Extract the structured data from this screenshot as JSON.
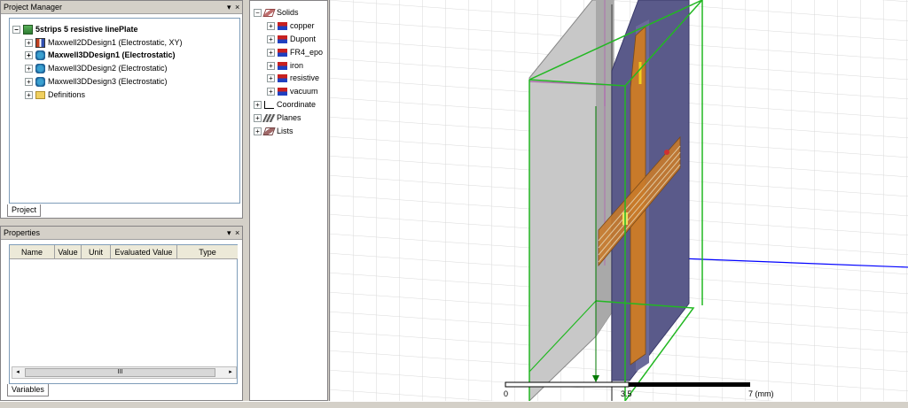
{
  "project_manager": {
    "title": "Project Manager",
    "pin": "▾",
    "close": "×",
    "tab": "Project",
    "root": "5strips 5 resistive linePlate",
    "items": [
      {
        "label": "Maxwell2DDesign1 (Electrostatic, XY)"
      },
      {
        "label": "Maxwell3DDesign1 (Electrostatic)"
      },
      {
        "label": "Maxwell3DDesign2 (Electrostatic)"
      },
      {
        "label": "Maxwell3DDesign3 (Electrostatic)"
      },
      {
        "label": "Definitions"
      }
    ]
  },
  "properties": {
    "title": "Properties",
    "pin": "▾",
    "close": "×",
    "tab": "Variables",
    "columns": [
      "Name",
      "Value",
      "Unit",
      "Evaluated Value",
      "Type"
    ],
    "scroll_grip": "III",
    "scroll_left": "◂",
    "scroll_right": "▸"
  },
  "model_tree": {
    "solids": "Solids",
    "materials": [
      "copper",
      "Dupont",
      "FR4_epo",
      "iron",
      "resistive",
      "vacuum"
    ],
    "others": [
      "Coordinate",
      "Planes",
      "Lists"
    ]
  },
  "viewport": {
    "scale_labels": [
      "0",
      "3.5",
      "7 (mm)"
    ]
  },
  "colors": {
    "panel_bg": "#d4d0c8",
    "grid": "#d9d9d9",
    "bounding_box": "#22b822",
    "plate": "#5a5a8a",
    "strip": "#c87a2a",
    "axis_blue": "#0000ff",
    "axis_green": "#007a00"
  }
}
